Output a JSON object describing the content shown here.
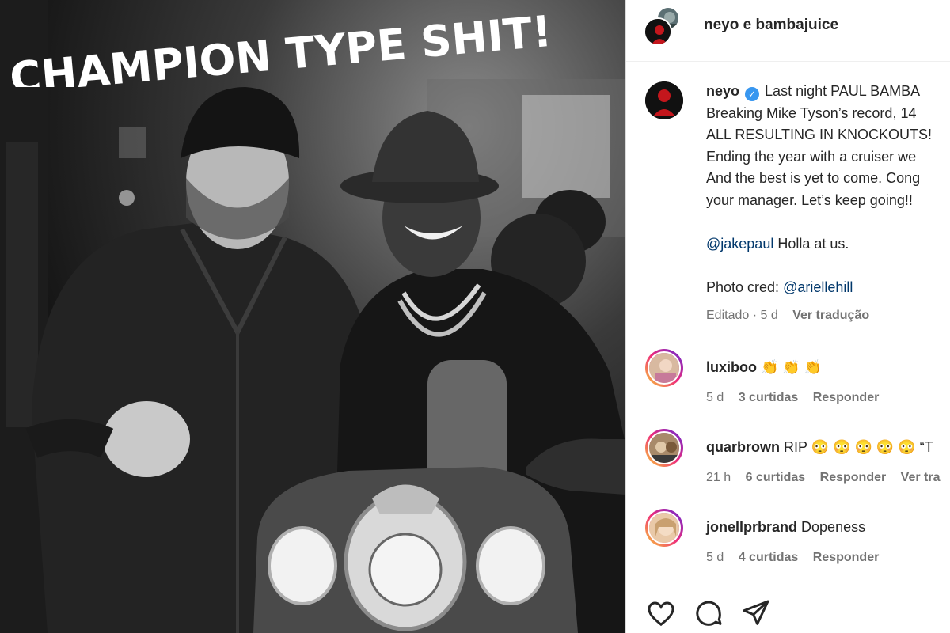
{
  "photo": {
    "overlay_text": "CHAMPION TYPE SHIT!!"
  },
  "header": {
    "names": "neyo e bambajuice"
  },
  "caption": {
    "username": "neyo",
    "verified_icon": "check",
    "lines": [
      "Last night PAUL BAMBA",
      "Breaking Mike Tyson’s record, 14",
      "ALL RESULTING IN KNOCKOUTS!",
      "Ending the year with a cruiser we",
      "And the best is yet to come. Cong",
      "your manager. Let’s keep going!!"
    ],
    "mention_line": {
      "mention": "@jakepaul",
      "text": " Holla at us."
    },
    "credit_line": {
      "text": "Photo cred: ",
      "mention": "@ariellehill"
    },
    "meta": {
      "edited": "Editado · 5 d",
      "translate": "Ver tradução"
    }
  },
  "comments": [
    {
      "username": "luxiboo",
      "text": "👏 👏 👏",
      "time": "5 d",
      "likes": "3 curtidas",
      "reply": "Responder"
    },
    {
      "username": "quarbrown",
      "text": "RIP 😳 😳 😳 😳 😳 “T",
      "time": "21 h",
      "likes": "6 curtidas",
      "reply": "Responder",
      "translate": "Ver tra"
    },
    {
      "username": "jonellprbrand",
      "text": "Dopeness",
      "time": "5 d",
      "likes": "4 curtidas",
      "reply": "Responder"
    }
  ],
  "actions": {
    "icons": [
      "heart-icon",
      "comment-icon",
      "share-icon"
    ]
  },
  "colors": {
    "link": "#00376b",
    "verified": "#3897f0",
    "meta": "#737373",
    "story_ring": "#ee2a7b"
  }
}
